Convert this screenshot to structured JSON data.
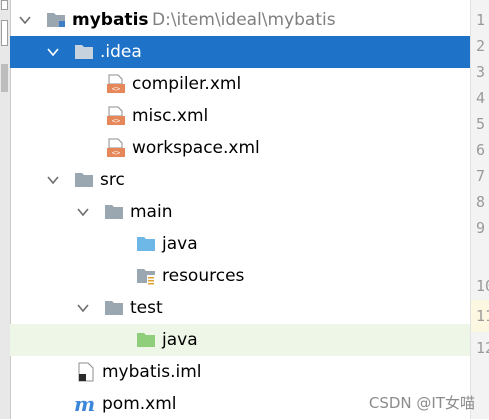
{
  "project": {
    "name": "mybatis",
    "path": "D:\\item\\ideal\\mybatis"
  },
  "tree": {
    "idea": ".idea",
    "compiler": "compiler.xml",
    "misc": "misc.xml",
    "workspace": "workspace.xml",
    "src": "src",
    "main": "main",
    "java_main": "java",
    "resources": "resources",
    "test": "test",
    "java_test": "java",
    "iml": "mybatis.iml",
    "pom": "pom.xml"
  },
  "gutter": {
    "lines": [
      "1",
      "2",
      "3",
      "4",
      "5",
      "6",
      "7",
      "8",
      "9",
      "10",
      "11",
      "12"
    ]
  },
  "watermark": "CSDN @IT女喵",
  "colors": {
    "selection": "#1e73c8",
    "highlight_row": "#eef6e7",
    "folder_gray": "#9aa7b0",
    "folder_blue_source": "#6db8e6",
    "folder_green_test": "#8fce7a",
    "xml_orange": "#e6875a"
  }
}
